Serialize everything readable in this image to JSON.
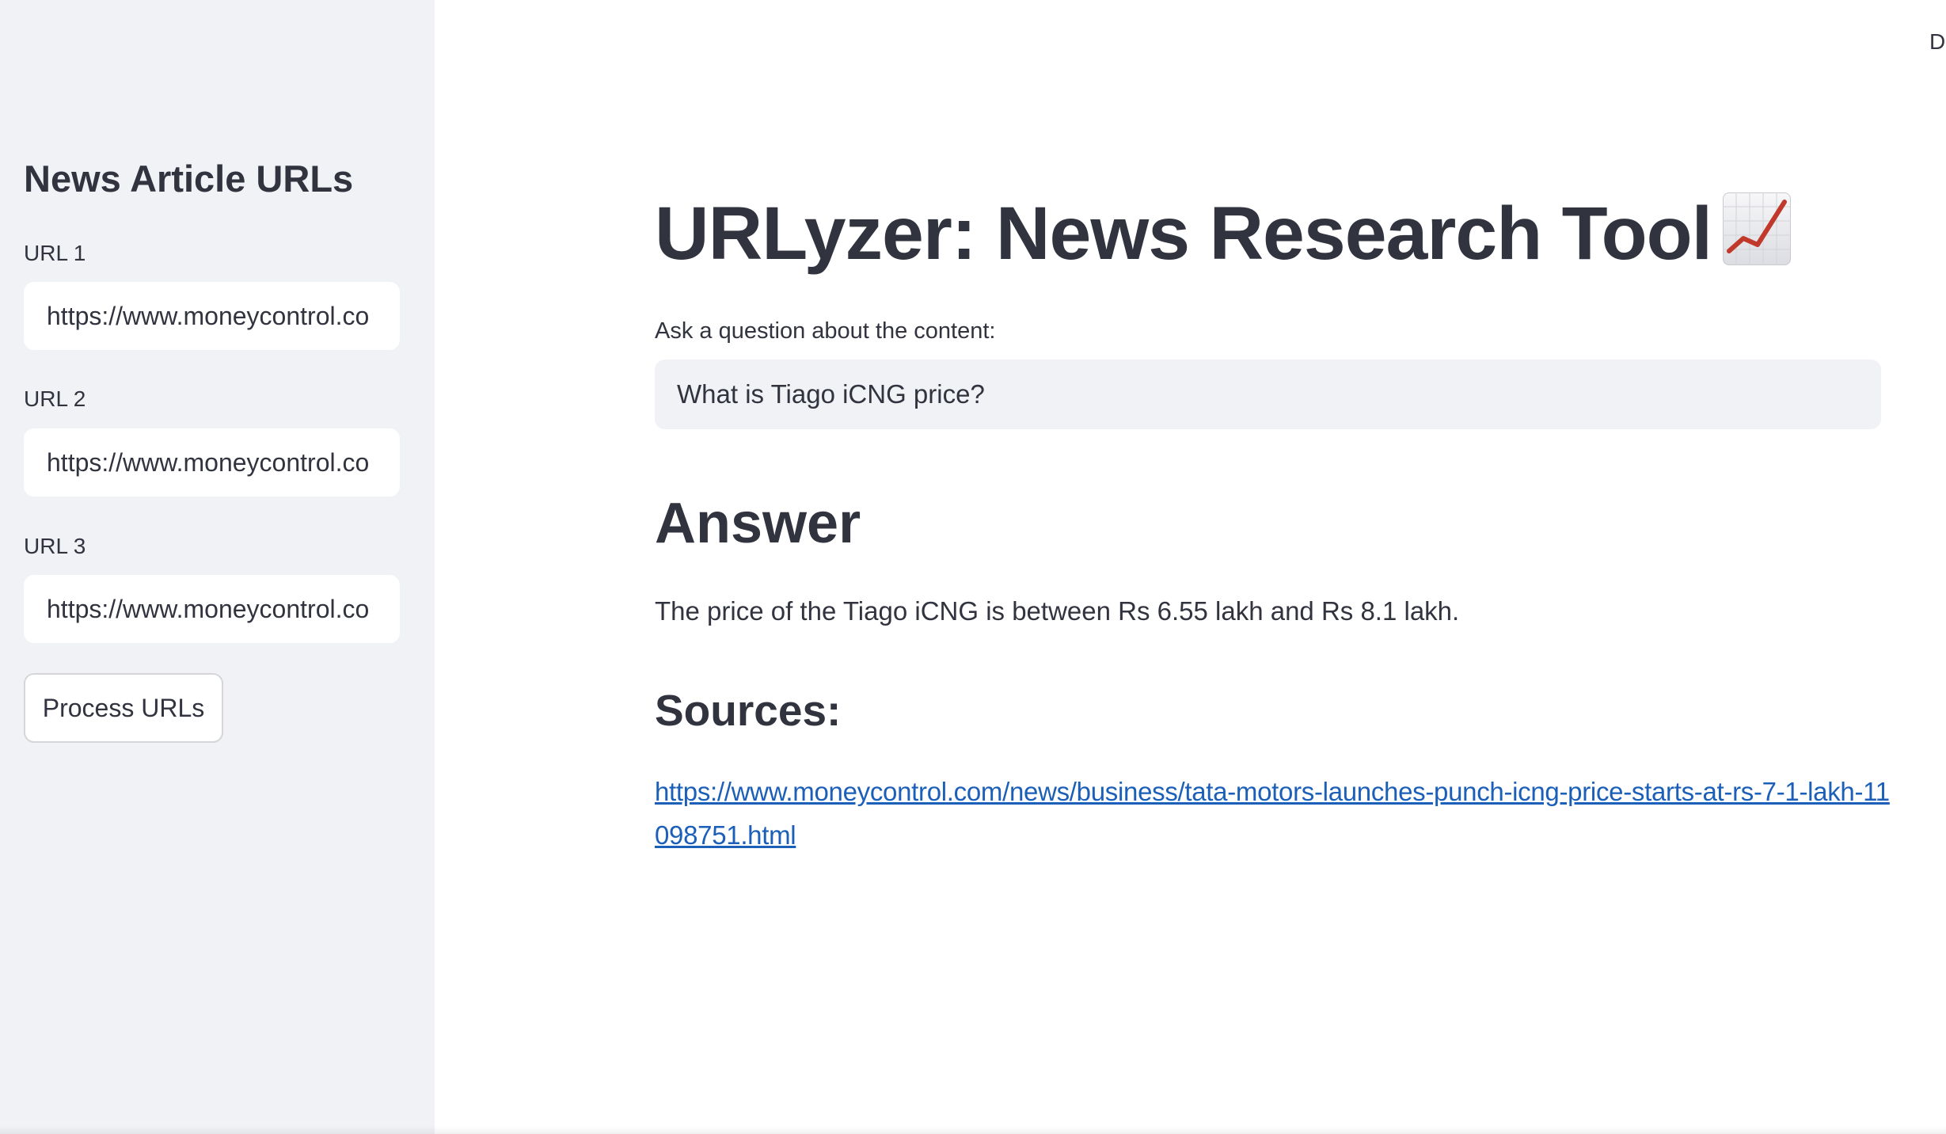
{
  "sidebar": {
    "title": "News Article URLs",
    "urls": [
      {
        "label": "URL 1",
        "value": "https://www.moneycontrol.co"
      },
      {
        "label": "URL 2",
        "value": "https://www.moneycontrol.co"
      },
      {
        "label": "URL 3",
        "value": "https://www.moneycontrol.co"
      }
    ],
    "process_button_label": "Process URLs"
  },
  "header": {
    "deploy_label": "De"
  },
  "main": {
    "title": "URLyzer: News Research Tool",
    "title_icon": "chart-increasing-icon",
    "question_label": "Ask a question about the content:",
    "question_value": "What is Tiago iCNG price?",
    "answer_heading": "Answer",
    "answer_text": "The price of the Tiago iCNG is between Rs 6.55 lakh and Rs 8.1 lakh.",
    "sources_heading": "Sources:",
    "source_link": "https://www.moneycontrol.com/news/business/tata-motors-launches-punch-icng-price-starts-at-rs-7-1-lakh-11098751.html"
  },
  "colors": {
    "sidebar_bg": "#f0f2f6",
    "text": "#31333f",
    "link": "#1c5fb8",
    "chart_line": "#c0392b"
  }
}
